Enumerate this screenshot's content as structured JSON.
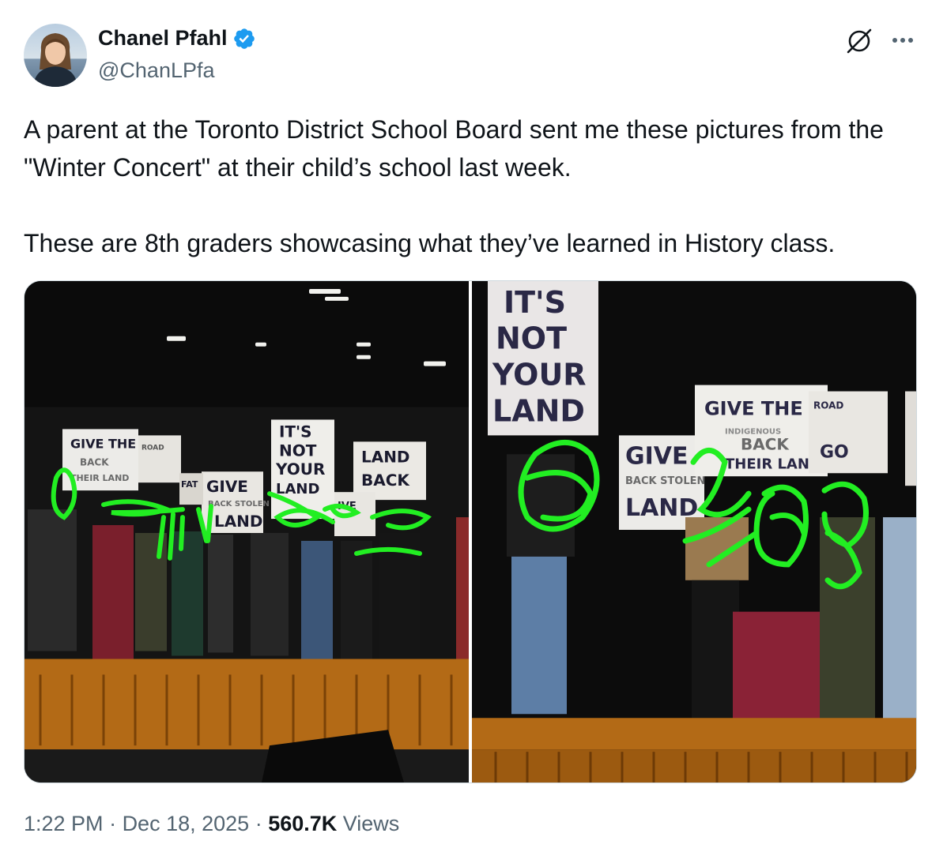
{
  "author": {
    "name": "Chanel Pfahl",
    "handle": "@ChanLPfa",
    "verified": true,
    "avatar_icon": "profile-photo"
  },
  "icons": {
    "grok": "grok-icon",
    "more": "more-icon",
    "verified": "verified-badge-icon"
  },
  "colors": {
    "text_primary": "#0f1419",
    "text_secondary": "#536471",
    "verified_blue": "#1d9bf0",
    "border": "#cfd9de"
  },
  "tweet": {
    "paragraphs": [
      "A parent at the Toronto District School Board sent me these pictures from the \"Winter Concert\" at their child’s school last week.",
      "These are 8th graders showcasing what they’ve learned in History class."
    ]
  },
  "photos": [
    {
      "signs": [
        "GIVE THE",
        "BACK",
        "THEIR LAND",
        "IT'S",
        "NOT",
        "YOUR",
        "LAND",
        "LAND",
        "BACK",
        "GIVE",
        "BACK STOLEN",
        "LAND",
        "FAT",
        "IVE",
        "ROAD"
      ]
    },
    {
      "signs": [
        "IT'S",
        "NOT",
        "YOUR",
        "LAND",
        "GIVE",
        "BACK STOLEN",
        "LAND",
        "GIVE THE",
        "INDIGENOUS",
        "BACK",
        "THEIR LAND",
        "ROAD",
        "GO"
      ]
    }
  ],
  "meta": {
    "time": "1:22 PM",
    "sep1": " · ",
    "date": "Dec 18, 2025",
    "sep2": " · ",
    "views": "560.7K",
    "views_label": " Views"
  }
}
